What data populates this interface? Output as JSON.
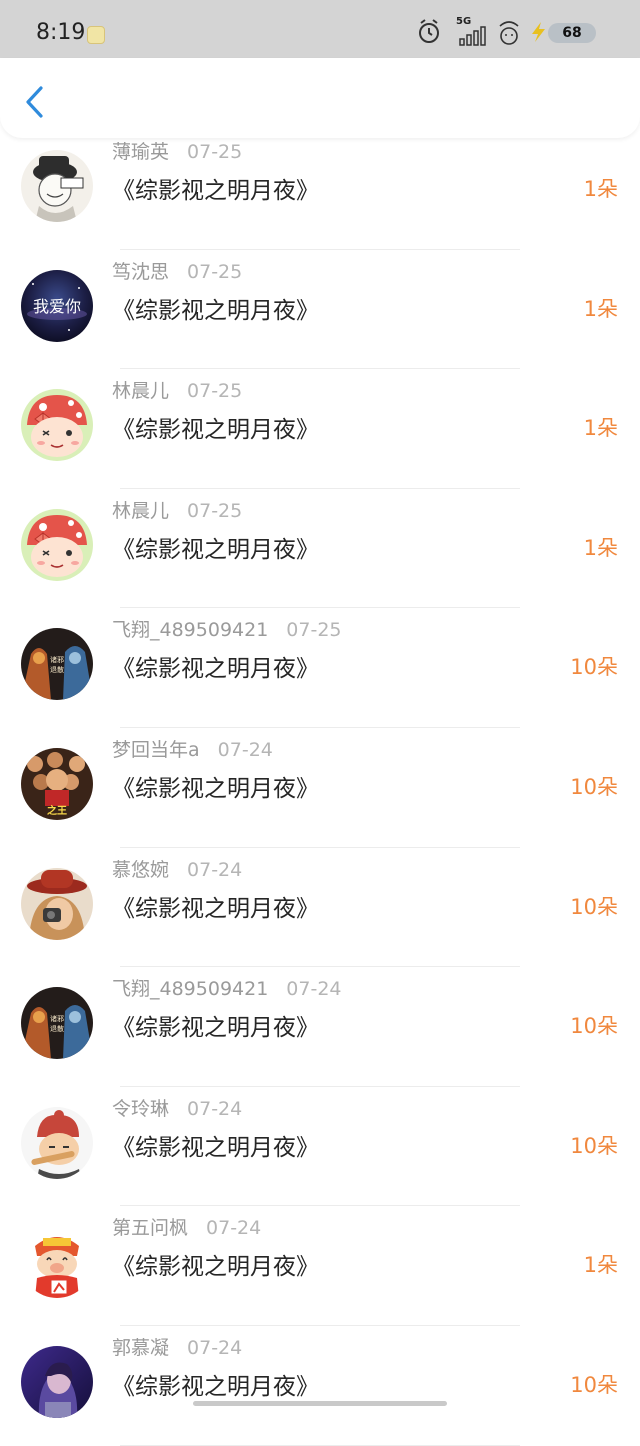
{
  "status_bar": {
    "time": "8:19",
    "network": "5G",
    "battery": "68"
  },
  "header": {
    "back_icon": "chevron-left-icon"
  },
  "colors": {
    "accent_orange": "#f0883e",
    "back_blue": "#2f8bdc"
  },
  "gifts": [
    {
      "name": "薄瑜英",
      "date": "07-25",
      "title": "《综影视之明月夜》",
      "amount": "1朵",
      "avatar": "avatar-hat-sketch"
    },
    {
      "name": "笃沈思",
      "date": "07-25",
      "title": "《综影视之明月夜》",
      "amount": "1朵",
      "avatar": "avatar-galaxy-text"
    },
    {
      "name": "林晨儿",
      "date": "07-25",
      "title": "《综影视之明月夜》",
      "amount": "1朵",
      "avatar": "avatar-mushroom-girl"
    },
    {
      "name": "林晨儿",
      "date": "07-25",
      "title": "《综影视之明月夜》",
      "amount": "1朵",
      "avatar": "avatar-mushroom-girl"
    },
    {
      "name": "飞翔_489509421",
      "date": "07-25",
      "title": "《综影视之明月夜》",
      "amount": "10朵",
      "avatar": "avatar-poster-dark"
    },
    {
      "name": "梦回当年a",
      "date": "07-24",
      "title": "《综影视之明月夜》",
      "amount": "10朵",
      "avatar": "avatar-movie-poster"
    },
    {
      "name": "慕悠婉",
      "date": "07-24",
      "title": "《综影视之明月夜》",
      "amount": "10朵",
      "avatar": "avatar-red-hat-girl"
    },
    {
      "name": "飞翔_489509421",
      "date": "07-24",
      "title": "《综影视之明月夜》",
      "amount": "10朵",
      "avatar": "avatar-poster-dark"
    },
    {
      "name": "令玲琳",
      "date": "07-24",
      "title": "《综影视之明月夜》",
      "amount": "10朵",
      "avatar": "avatar-cartoon-boy"
    },
    {
      "name": "第五问枫",
      "date": "07-24",
      "title": "《综影视之明月夜》",
      "amount": "1朵",
      "avatar": "avatar-fortune-pig"
    },
    {
      "name": "郭慕凝",
      "date": "07-24",
      "title": "《综影视之明月夜》",
      "amount": "10朵",
      "avatar": "avatar-purple-photo"
    }
  ]
}
